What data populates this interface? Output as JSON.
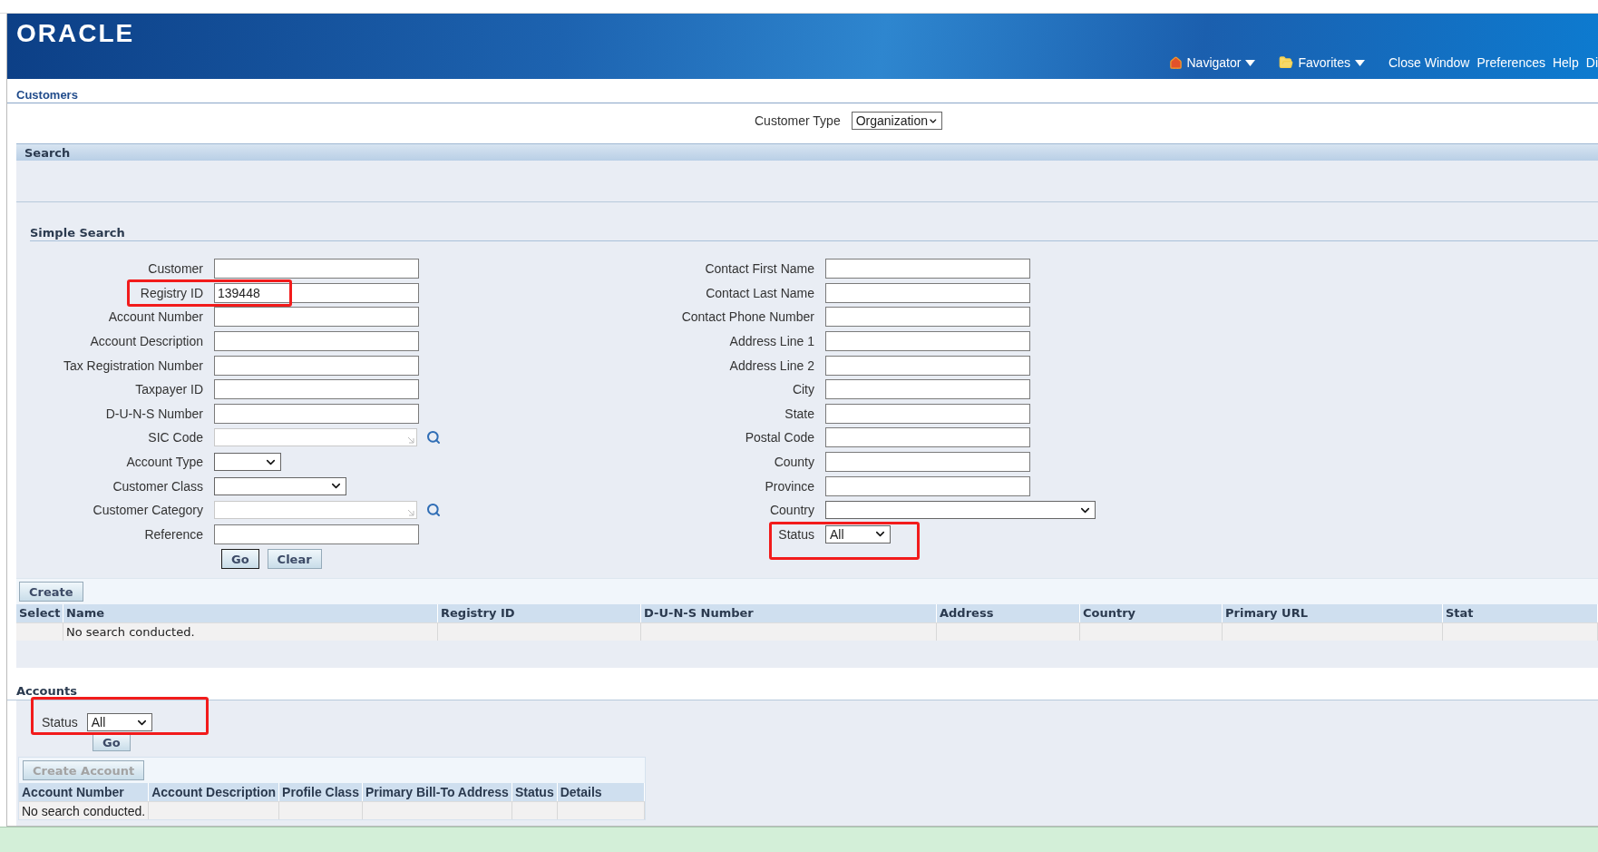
{
  "header": {
    "logo": "ORACLE",
    "menus": [
      {
        "label": "Navigator"
      },
      {
        "label": "Favorites"
      }
    ],
    "links": [
      "Close Window",
      "Preferences",
      "Help",
      "Di"
    ]
  },
  "page_title": "Customers",
  "customer_type": {
    "label": "Customer Type",
    "value": "Organization"
  },
  "search": {
    "title": "Search",
    "subtitle": "Simple Search",
    "left_fields": [
      {
        "label": "Customer",
        "kind": "text",
        "highlighted": false
      },
      {
        "label": "Registry ID",
        "kind": "text",
        "value": "139448",
        "highlighted": true
      },
      {
        "label": "Account Number",
        "kind": "text",
        "highlighted": false
      },
      {
        "label": "Account Description",
        "kind": "text",
        "highlighted": false
      },
      {
        "label": "Tax Registration Number",
        "kind": "text",
        "highlighted": false
      },
      {
        "label": "Taxpayer ID",
        "kind": "text",
        "highlighted": false
      },
      {
        "label": "D-U-N-S Number",
        "kind": "text",
        "highlighted": false
      },
      {
        "label": "SIC Code",
        "kind": "lookup",
        "highlighted": false
      },
      {
        "label": "Account Type",
        "kind": "select",
        "highlighted": false
      },
      {
        "label": "Customer Class",
        "kind": "select",
        "highlighted": false
      },
      {
        "label": "Customer Category",
        "kind": "lookup",
        "highlighted": false
      },
      {
        "label": "Reference",
        "kind": "text",
        "highlighted": false
      }
    ],
    "right_fields": [
      {
        "label": "Contact First Name",
        "kind": "text",
        "highlighted": false
      },
      {
        "label": "Contact Last Name",
        "kind": "text",
        "highlighted": false
      },
      {
        "label": "Contact Phone Number",
        "kind": "text",
        "highlighted": false
      },
      {
        "label": "Address Line 1",
        "kind": "text",
        "highlighted": false
      },
      {
        "label": "Address Line 2",
        "kind": "text",
        "highlighted": false
      },
      {
        "label": "City",
        "kind": "text",
        "highlighted": false
      },
      {
        "label": "State",
        "kind": "text",
        "highlighted": false
      },
      {
        "label": "Postal Code",
        "kind": "text",
        "highlighted": false
      },
      {
        "label": "County",
        "kind": "text",
        "highlighted": false
      },
      {
        "label": "Province",
        "kind": "text",
        "highlighted": false
      },
      {
        "label": "Country",
        "kind": "select",
        "highlighted": false
      },
      {
        "label": "Status",
        "kind": "select",
        "value": "All",
        "highlighted": true
      }
    ],
    "buttons": [
      {
        "label": "Go",
        "default": true
      },
      {
        "label": "Clear",
        "default": false
      }
    ]
  },
  "results": {
    "create_button": "Create",
    "columns": [
      "Select",
      "Name",
      "Registry ID",
      "D-U-N-S Number",
      "Address",
      "Country",
      "Primary URL",
      "Stat"
    ],
    "empty_message": "No search conducted."
  },
  "accounts": {
    "title": "Accounts",
    "status": {
      "label": "Status",
      "value": "All",
      "highlighted": true
    },
    "go_button": "Go",
    "create_button": {
      "label": "Create Account",
      "disabled": true
    },
    "columns": [
      "Account Number",
      "Account Description",
      "Profile Class",
      "Primary Bill-To Address",
      "Status",
      "Details"
    ],
    "empty_message": "No search conducted."
  }
}
